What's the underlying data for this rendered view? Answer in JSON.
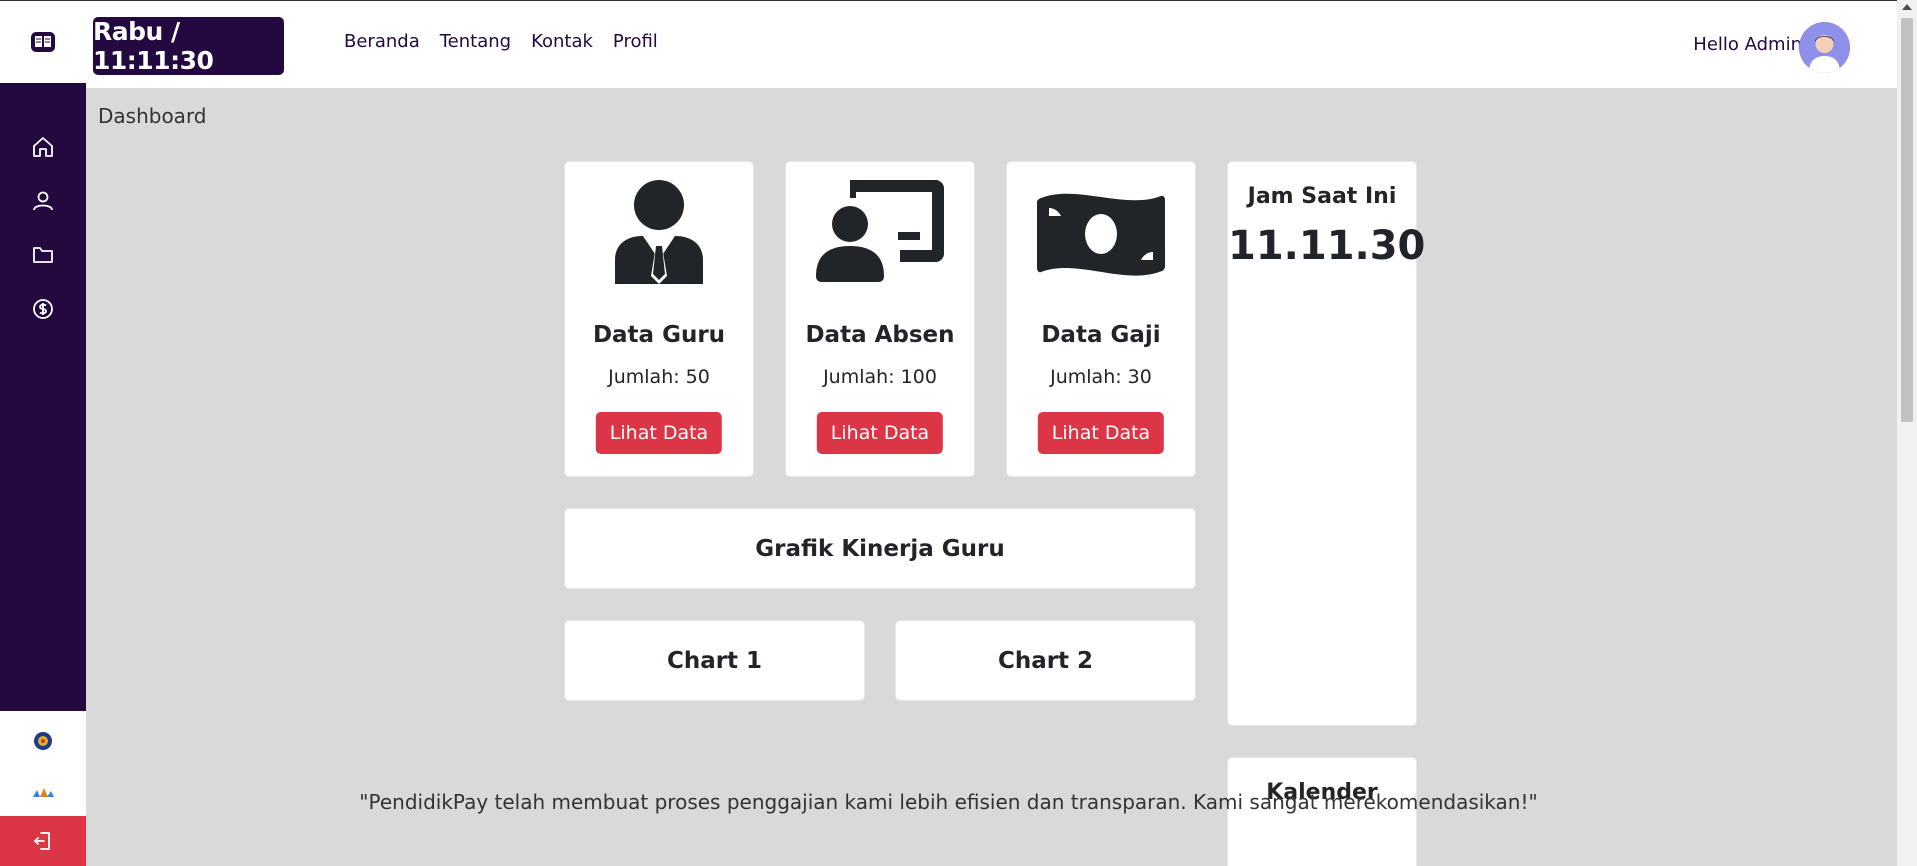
{
  "topbar": {
    "clock_badge": "Rabu / 11:11:30",
    "nav": [
      "Beranda",
      "Tentang",
      "Kontak",
      "Profil"
    ],
    "hello": "Hello Admin"
  },
  "breadcrumb": "Dashboard",
  "stats": [
    {
      "title": "Data Guru",
      "count": "Jumlah: 50",
      "button": "Lihat Data",
      "icon": "teacher-icon"
    },
    {
      "title": "Data Absen",
      "count": "Jumlah: 100",
      "button": "Lihat Data",
      "icon": "presentation-icon"
    },
    {
      "title": "Data Gaji",
      "count": "Jumlah: 30",
      "button": "Lihat Data",
      "icon": "money-icon"
    }
  ],
  "performance": {
    "title": "Grafik Kinerja Guru"
  },
  "charts": [
    "Chart 1",
    "Chart 2"
  ],
  "clock": {
    "label": "Jam Saat Ini",
    "time": "11.11.30"
  },
  "calendar": {
    "label": "Kalender"
  },
  "testimonial": "\"PendidikPay telah membuat proses penggajian kami lebih efisien dan transparan. Kami sangat merekomendasikan!\"",
  "colors": {
    "primary": "#23093f",
    "danger": "#dc3545",
    "background": "#d9d9d9"
  }
}
